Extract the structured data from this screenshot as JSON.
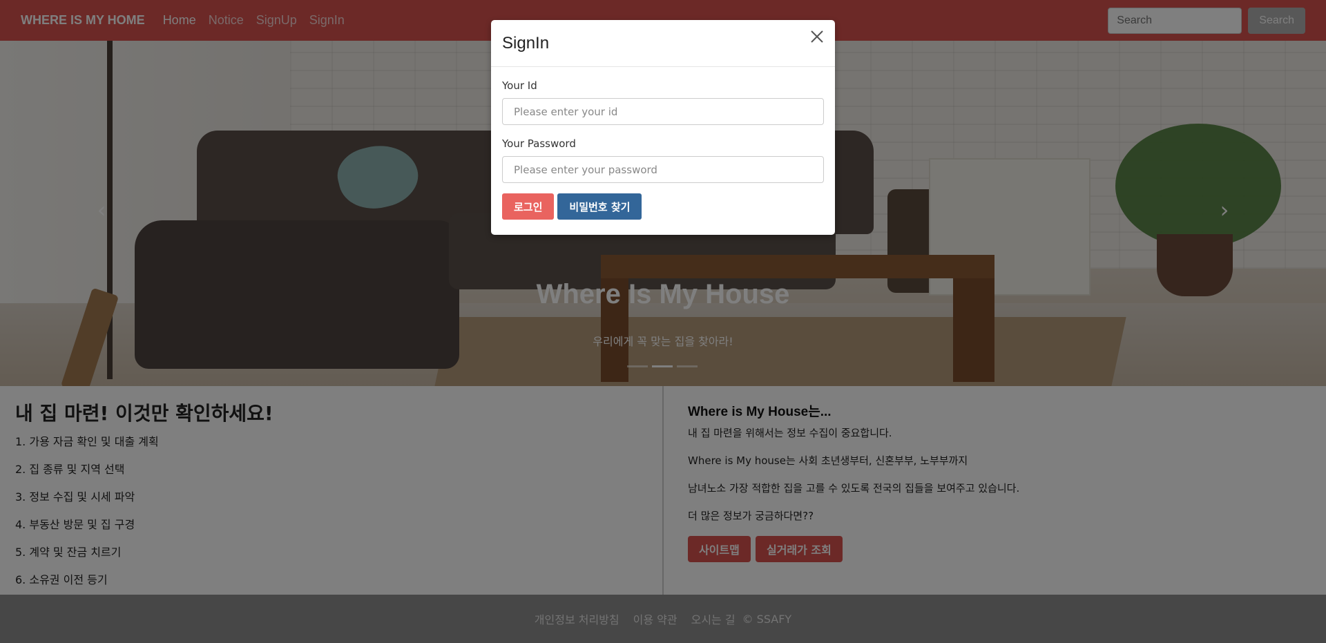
{
  "navbar": {
    "brand": "WHERE IS MY HOME",
    "links": [
      "Home",
      "Notice",
      "SignUp",
      "SignIn"
    ],
    "search_placeholder": "Search",
    "search_button": "Search",
    "color": "#d9534f"
  },
  "hero": {
    "title": "Where Is My House",
    "subtitle": "우리에게 꼭 맞는 집을 찾아라!",
    "slides": 3,
    "active_slide": 2,
    "prev_icon": "chevron-left-icon",
    "next_icon": "chevron-right-icon"
  },
  "info": {
    "title": "내 집 마련! 이것만 확인하세요!",
    "steps": [
      "1. 가용 자금 확인 및 대출 계획",
      "2. 집 종류 및 지역 선택",
      "3. 정보 수집 및 시세 파악",
      "4. 부동산 방문 및 집 구경",
      "5. 계약 및 잔금 치르기",
      "6. 소유권 이전 등기"
    ],
    "right_title": "Where is My House는...",
    "right_paragraphs": [
      "내 집 마련을 위해서는 정보 수집이 중요합니다.",
      "Where is My house는 사회 초년생부터, 신혼부부, 노부부까지",
      "남녀노소 가장 적합한 집을 고를 수 있도록 전국의 집들을 보여주고 있습니다.",
      "더 많은 정보가 궁금하다면??"
    ],
    "buttons": [
      "사이트맵",
      "실거래가 조회"
    ]
  },
  "footer": {
    "links": [
      "개인정보 처리방침",
      "이용 약관",
      "오시는 길"
    ],
    "copyright": "© SSAFY"
  },
  "modal": {
    "title": "SignIn",
    "close_icon": "close-icon",
    "id_label": "Your Id",
    "id_placeholder": "Please enter your id",
    "id_value": "",
    "password_label": "Your Password",
    "password_placeholder": "Please enter your password",
    "password_value": "",
    "login_button": "로그인",
    "find_password_button": "비밀번호 찾기",
    "login_color": "#e9635f",
    "find_color": "#336699"
  }
}
